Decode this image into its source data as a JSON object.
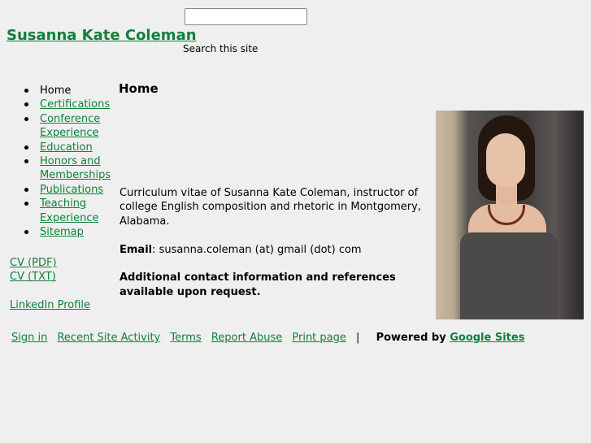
{
  "site": {
    "title": "Susanna Kate Coleman"
  },
  "search": {
    "label": "Search this site",
    "value": ""
  },
  "nav": {
    "items": [
      {
        "label": "Home",
        "current": true
      },
      {
        "label": "Certifications"
      },
      {
        "label": "Conference Experience"
      },
      {
        "label": "Education"
      },
      {
        "label": "Honors and Memberships"
      },
      {
        "label": "Publications"
      },
      {
        "label": "Teaching Experience"
      },
      {
        "label": "Sitemap"
      }
    ]
  },
  "side_links": {
    "cv_pdf": "CV (PDF)",
    "cv_txt": "CV (TXT)",
    "linkedin": "LinkedIn Profile"
  },
  "main": {
    "heading": "Home",
    "intro": "Curriculum vitae of Susanna Kate Coleman, instructor of college English composition and rhetoric in Montgomery, Alabama.",
    "email_label": "Email",
    "email_value": ": susanna.coleman (at) gmail (dot) com",
    "contact_note": "Additional contact information and references available upon request."
  },
  "footer": {
    "sign_in": "Sign in",
    "recent_activity": "Recent Site Activity",
    "terms": "Terms",
    "report_abuse": "Report Abuse",
    "print_page": "Print page",
    "separator": "|",
    "powered_by": "Powered by",
    "google_sites": "Google Sites"
  },
  "colors": {
    "link": "#11803b",
    "background": "#efefef"
  }
}
